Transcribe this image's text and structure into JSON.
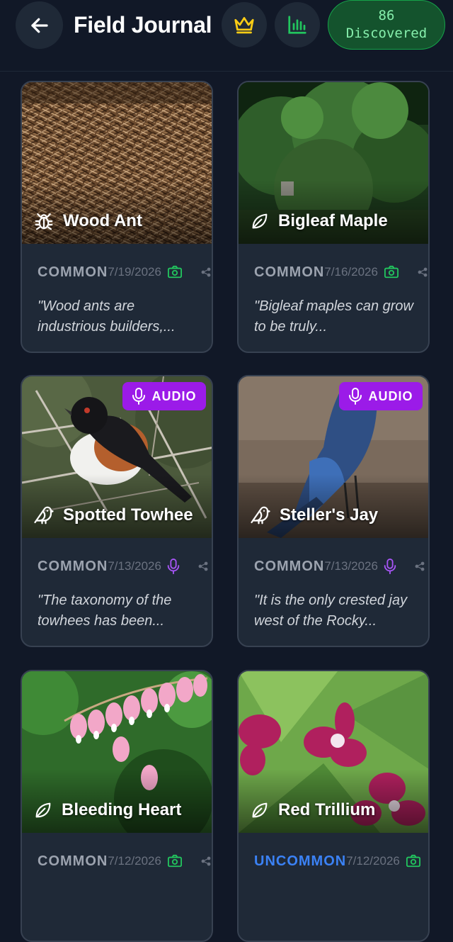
{
  "header": {
    "title": "Field Journal",
    "discovered_count": "86",
    "discovered_label": "Discovered"
  },
  "cards": [
    {
      "name": "Wood Ant",
      "icon": "bug-icon",
      "rarity": "COMMON",
      "date": "7/19/2026",
      "media": "camera-icon",
      "quote": "\"Wood ants are industrious builders,...",
      "audio": false
    },
    {
      "name": "Bigleaf Maple",
      "icon": "leaf-icon",
      "rarity": "COMMON",
      "date": "7/16/2026",
      "media": "camera-icon",
      "quote": "\"Bigleaf maples can grow to be truly...",
      "audio": false
    },
    {
      "name": "Spotted Towhee",
      "icon": "bird-icon",
      "rarity": "COMMON",
      "date": "7/13/2026",
      "media": "mic-icon",
      "quote": "\"The taxonomy of the towhees has been...",
      "audio": true,
      "audio_label": "AUDIO"
    },
    {
      "name": "Steller's Jay",
      "icon": "bird-icon",
      "rarity": "COMMON",
      "date": "7/13/2026",
      "media": "mic-icon",
      "quote": "\"It is the only crested jay west of the Rocky...",
      "audio": true,
      "audio_label": "AUDIO"
    },
    {
      "name": "Bleeding Heart",
      "icon": "leaf-icon",
      "rarity": "COMMON",
      "date": "7/12/2026",
      "media": "camera-icon",
      "quote": "",
      "audio": false
    },
    {
      "name": "Red Trillium",
      "icon": "leaf-icon",
      "rarity": "UNCOMMON",
      "date": "7/12/2026",
      "media": "camera-icon",
      "quote": "",
      "audio": false
    }
  ],
  "colors": {
    "background": "#111827",
    "card": "#1f2937",
    "audio_badge": "#9b1be8",
    "camera": "#22c55e",
    "mic": "#a855f7",
    "uncommon": "#3b82f6",
    "crown": "#facc15"
  }
}
